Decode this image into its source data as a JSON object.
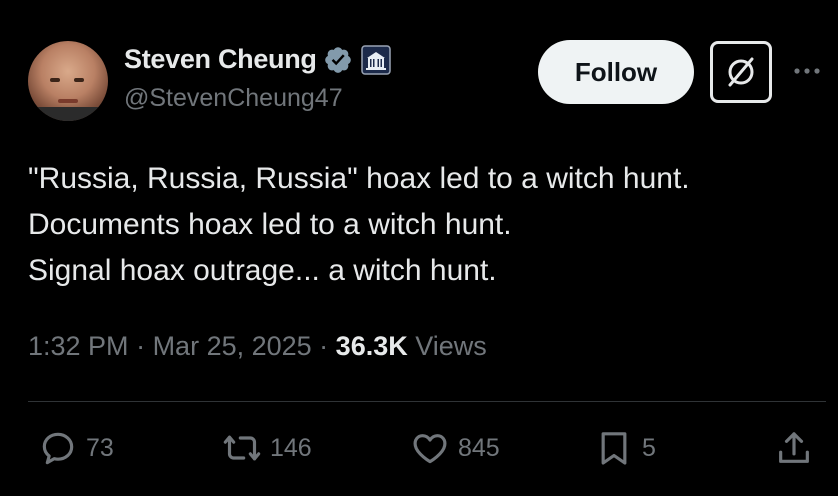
{
  "author": {
    "display_name": "Steven Cheung",
    "handle": "@StevenCheung47",
    "verified_icon": "verified-badge-icon",
    "affiliation_icon": "white-house-icon"
  },
  "header": {
    "follow_label": "Follow",
    "grok_icon": "grok-icon",
    "more_icon": "more-icon"
  },
  "tweet": {
    "lines": [
      "\"Russia, Russia, Russia\" hoax led to a witch hunt.",
      "Documents hoax led to a witch hunt.",
      "Signal hoax outrage... a witch hunt."
    ]
  },
  "meta": {
    "time": "1:32 PM",
    "separator": " · ",
    "date": "Mar 25, 2025",
    "views_count": "36.3K",
    "views_label": " Views"
  },
  "actions": {
    "replies": "73",
    "reposts": "146",
    "likes": "845",
    "bookmarks": "5"
  },
  "colors": {
    "background": "#000000",
    "text": "#e7e9ea",
    "secondary": "#71767b",
    "verified": "#829aab",
    "follow_bg": "#eff3f4"
  }
}
